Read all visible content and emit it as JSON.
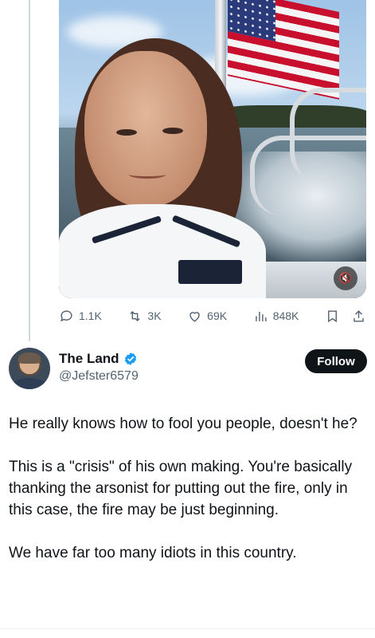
{
  "media": {
    "mute_icon": "speaker-muted-icon",
    "mute_glyph": "🔇"
  },
  "actions": {
    "replies": "1.1K",
    "reposts": "3K",
    "likes": "69K",
    "views": "848K",
    "icons": [
      "reply-icon",
      "repost-icon",
      "like-icon",
      "views-icon",
      "bookmark-icon",
      "share-icon"
    ]
  },
  "author": {
    "name": "The Land",
    "handle": "@Jefster6579",
    "verified_color": "#1d9bf0",
    "follow_label": "Follow"
  },
  "post": {
    "paragraphs": [
      "He really knows how to fool you people, doesn't he?",
      "This is a \"crisis\" of his own making. You're basically thanking the arsonist for putting out the fire, only in this case, the fire may be just beginning.",
      "We have far too many idiots in this country."
    ]
  }
}
